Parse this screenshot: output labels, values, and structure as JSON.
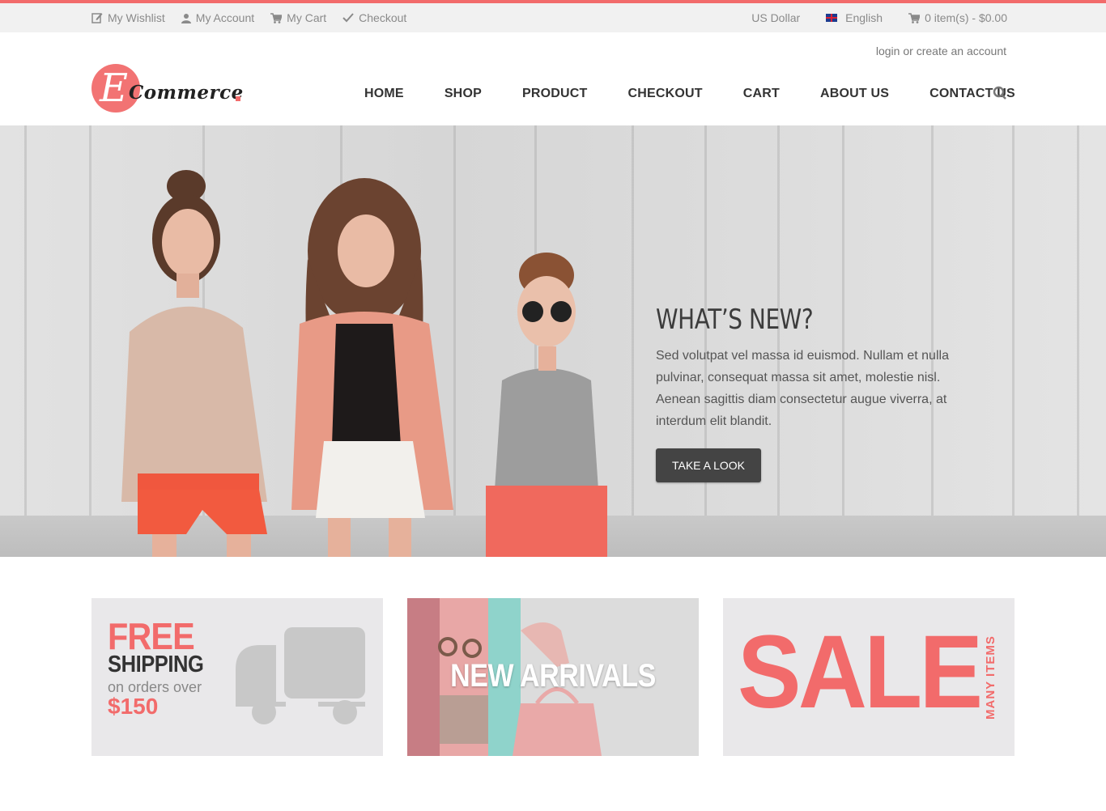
{
  "colors": {
    "accent": "#f26b6b",
    "dark_button": "#444444",
    "topbar_bg": "#f1f1f1"
  },
  "topbar": {
    "links": [
      {
        "label": "My Wishlist",
        "icon": "edit-icon"
      },
      {
        "label": "My Account",
        "icon": "user-icon"
      },
      {
        "label": "My Cart",
        "icon": "cart-icon"
      },
      {
        "label": "Checkout",
        "icon": "checkmark-icon"
      }
    ],
    "currency": "US Dollar",
    "language": "English",
    "cart_summary": "0 item(s) - $0.00"
  },
  "header": {
    "auth": {
      "login": "login",
      "separator": "or",
      "create": "create an account"
    },
    "logo": {
      "letter": "E",
      "word": "Commerce"
    },
    "nav": [
      "HOME",
      "SHOP",
      "PRODUCT",
      "CHECKOUT",
      "CART",
      "ABOUT US",
      "CONTACT US"
    ]
  },
  "hero": {
    "title": "WHAT’S NEW?",
    "text": "Sed volutpat vel massa id euismod. Nullam et nulla pulvinar, consequat massa sit amet, molestie nisl. Aenean sagittis diam consectetur augue viverra, at interdum elit blandit.",
    "button": "TAKE A LOOK"
  },
  "promos": {
    "shipping": {
      "free": "FREE",
      "shipping": "SHIPPING",
      "orders": "on orders over",
      "price": "$150"
    },
    "arrivals": {
      "label": "NEW ARRIVALS"
    },
    "sale": {
      "label": "SALE",
      "sub": "MANY ITEMS"
    }
  }
}
